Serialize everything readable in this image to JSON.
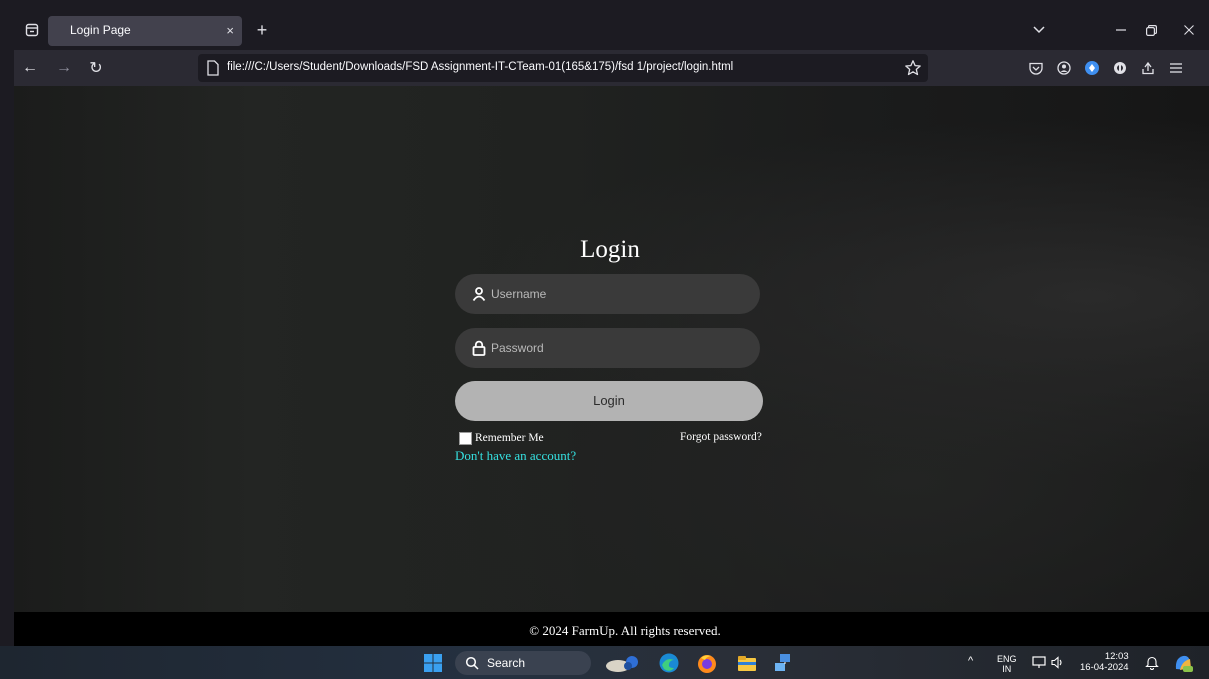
{
  "browser": {
    "tab_title": "Login Page",
    "tab_close_glyph": "×",
    "new_tab_glyph": "+",
    "url": "file:///C:/Users/Student/Downloads/FSD Assignment-IT-CTeam-01(165&175)/fsd 1/project/login.html",
    "window_controls": {
      "list_all_tabs": "⌄",
      "minimize": "–",
      "restore": "❐",
      "close": "✕"
    },
    "nav": {
      "back": "←",
      "forward": "→",
      "reload": "↻"
    },
    "toolbar_icons": [
      "pocket-icon",
      "account-icon",
      "extension-blue-icon",
      "privacy-badger-icon",
      "share-icon",
      "menu-icon"
    ]
  },
  "page": {
    "heading": "Login",
    "username_placeholder": "Username",
    "password_placeholder": "Password",
    "login_button": "Login",
    "remember_me": "Remember Me",
    "forgot_password": "Forgot password?",
    "signup_link": "Don't have an account?",
    "footer": "© 2024 FarmUp. All rights reserved.",
    "colors": {
      "input_bg": "#3a3a3a",
      "button_bg": "#b3b3b3",
      "link": "#35e0e0",
      "footer_bg": "#000000"
    }
  },
  "taskbar": {
    "search_label": "Search",
    "tray": {
      "chevron": "^",
      "lang_line1": "ENG",
      "lang_line2": "IN",
      "time": "12:03",
      "date": "16-04-2024"
    }
  }
}
